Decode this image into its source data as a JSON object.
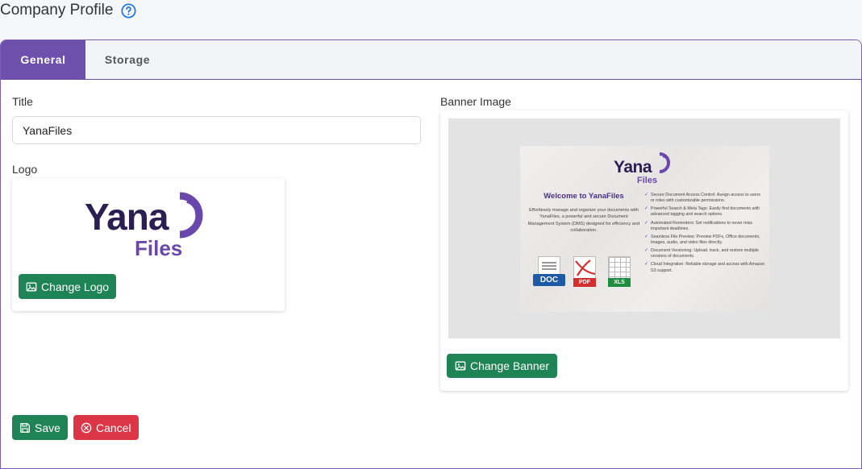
{
  "header": {
    "title": "Company Profile",
    "help_icon": "question-circle-icon"
  },
  "tabs": [
    {
      "label": "General",
      "active": true
    },
    {
      "label": "Storage",
      "active": false
    }
  ],
  "form": {
    "title_label": "Title",
    "title_value": "YanaFiles",
    "logo_label": "Logo",
    "banner_label": "Banner Image",
    "change_logo_label": "Change Logo",
    "change_banner_label": "Change Banner",
    "save_label": "Save",
    "cancel_label": "Cancel"
  },
  "logo": {
    "word": "Yana",
    "sub": "Files"
  },
  "banner": {
    "brand_word": "Yana",
    "brand_sub": "Files",
    "welcome": "Welcome to YanaFiles",
    "intro": "Effortlessly manage and organize your documents with YanaFiles, a powerful and secure Document Management System (DMS) designed for efficiency and collaboration.",
    "features": [
      "Secure Document Access Control: Assign access to users or roles with customizable permissions.",
      "Powerful Search & Meta Tags: Easily find documents with advanced tagging and search options.",
      "Automated Reminders: Set notifications to never miss important deadlines.",
      "Seamless File Preview: Preview PDFs, Office documents, images, audio, and video files directly.",
      "Document Versioning: Upload, track, and restore multiple versions of documents.",
      "Cloud Integration: Reliable storage and access with Amazon S3 support."
    ],
    "file_badges": [
      "DOC",
      "PDF",
      "XLS"
    ]
  },
  "colors": {
    "brand_purple": "#6d4fac",
    "logo_navy": "#2a1f52",
    "logo_purple": "#6a47ad",
    "btn_green": "#1e8455",
    "btn_red": "#dc3545",
    "help_blue": "#1a73e8"
  }
}
